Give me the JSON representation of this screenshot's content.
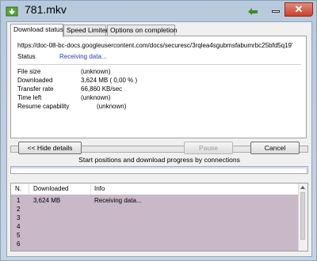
{
  "window": {
    "title": "781.mkv"
  },
  "tabs": [
    {
      "label": "Download status"
    },
    {
      "label": "Speed Limiter"
    },
    {
      "label": "Options on completion"
    }
  ],
  "status_panel": {
    "url": "https://doc-08-bc-docs.googleusercontent.com/docs/securesc/3rqlea4sgubmsfabumrbc25bfd5q19'",
    "status_label": "Status",
    "status_value": "Receiving data...",
    "file_size_label": "File size",
    "file_size_value": "(unknown)",
    "downloaded_label": "Downloaded",
    "downloaded_value": "3,624  MB  ( 0,00 % )",
    "transfer_rate_label": "Transfer rate",
    "transfer_rate_value": "66,860  KB/sec",
    "time_left_label": "Time left",
    "time_left_value": "(unknown)",
    "resume_label": "Resume capability",
    "resume_value": "(unknown)"
  },
  "buttons": {
    "hide_details": "<< Hide details",
    "pause": "Pause",
    "cancel": "Cancel"
  },
  "connections_caption": "Start positions and download progress by connections",
  "connections_table": {
    "headers": [
      "N.",
      "Downloaded",
      "Info"
    ],
    "rows": [
      {
        "n": "1",
        "downloaded": "3,624 MB",
        "info": "Receiving data..."
      },
      {
        "n": "2",
        "downloaded": "",
        "info": ""
      },
      {
        "n": "3",
        "downloaded": "",
        "info": ""
      },
      {
        "n": "4",
        "downloaded": "",
        "info": ""
      },
      {
        "n": "5",
        "downloaded": "",
        "info": ""
      },
      {
        "n": "6",
        "downloaded": "",
        "info": ""
      }
    ]
  },
  "colors": {
    "status_value": "#2a3bb0",
    "rows_background": "#c8b8c8"
  }
}
